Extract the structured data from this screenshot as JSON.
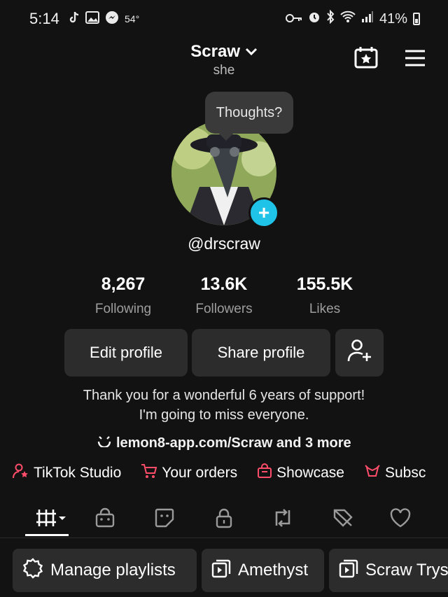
{
  "status_bar": {
    "time": "5:14",
    "temperature": "54°",
    "battery": "41%",
    "icons_left": [
      "tiktok-icon",
      "image-icon",
      "messenger-icon"
    ],
    "icons_right": [
      "key-icon",
      "alarm-icon",
      "bluetooth-icon",
      "wifi-icon",
      "signal-icon",
      "battery-icon"
    ]
  },
  "header": {
    "username": "Scraw",
    "pronouns": "she",
    "icons": [
      "calendar-star-icon",
      "menu-icon"
    ]
  },
  "profile": {
    "note_bubble": "Thoughts?",
    "handle": "@drscraw",
    "stats": [
      {
        "value": "8,267",
        "label": "Following"
      },
      {
        "value": "13.6K",
        "label": "Followers"
      },
      {
        "value": "155.5K",
        "label": "Likes"
      }
    ],
    "buttons": {
      "edit": "Edit profile",
      "share": "Share profile"
    },
    "bio_line1": "Thank you for a wonderful 6 years of support!",
    "bio_line2": "I'm going to miss everyone.",
    "link": "lemon8-app.com/Scraw and 3 more"
  },
  "quick_links": [
    {
      "label": "TikTok Studio",
      "icon": "person-star-icon"
    },
    {
      "label": "Your orders",
      "icon": "cart-icon"
    },
    {
      "label": "Showcase",
      "icon": "bag-icon"
    },
    {
      "label": "Subsc",
      "icon": "subscription-icon"
    }
  ],
  "tabs": [
    "grid-icon",
    "shop-bag-icon",
    "sticker-icon",
    "lock-icon",
    "repost-icon",
    "tagged-icon",
    "heart-icon"
  ],
  "playlists": [
    {
      "label": "Manage playlists",
      "icon": "gear-icon"
    },
    {
      "label": "Amethyst",
      "icon": "playlist-icon"
    },
    {
      "label": "Scraw Trys",
      "icon": "playlist-icon"
    }
  ],
  "colors": {
    "background": "#121212",
    "button_bg": "#2c2c2c",
    "accent_cyan": "#20c3e8",
    "accent_pink": "#ff4d6a",
    "muted_text": "#9e9e9e"
  }
}
